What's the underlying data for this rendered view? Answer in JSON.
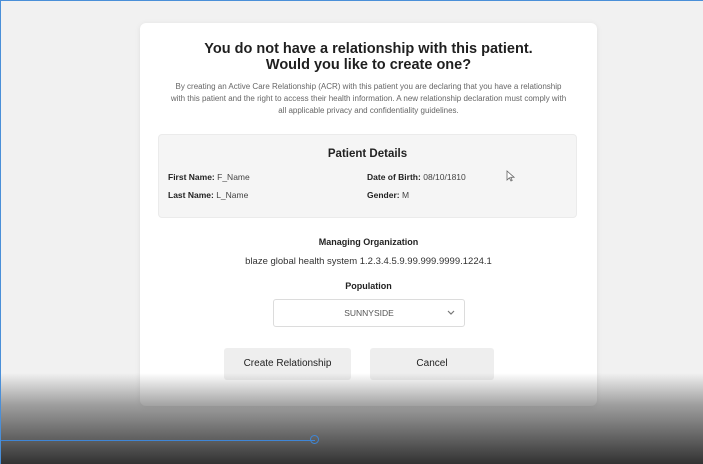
{
  "modal": {
    "title_line1": "You do not have a relationship with this patient.",
    "title_line2": "Would you like to create one?",
    "description": "By creating an Active Care Relationship (ACR) with this patient you are declaring that you have a relationship with this patient and the right to access their health information. A new relationship declaration must comply with all applicable privacy and confidentiality guidelines."
  },
  "patient_details": {
    "title": "Patient Details",
    "first_name_label": "First Name:",
    "first_name_value": "F_Name",
    "last_name_label": "Last Name:",
    "last_name_value": "L_Name",
    "dob_label": "Date of Birth:",
    "dob_value": "08/10/1810",
    "gender_label": "Gender:",
    "gender_value": "M"
  },
  "managing_organization": {
    "label": "Managing Organization",
    "value": "blaze global health system 1.2.3.4.5.9.99.999.9999.1224.1"
  },
  "population": {
    "label": "Population",
    "selected": "SUNNYSIDE",
    "chevron_icon": "chevron-down-icon"
  },
  "actions": {
    "create_label": "Create Relationship",
    "cancel_label": "Cancel"
  },
  "playback": {
    "progress": 0.45
  }
}
